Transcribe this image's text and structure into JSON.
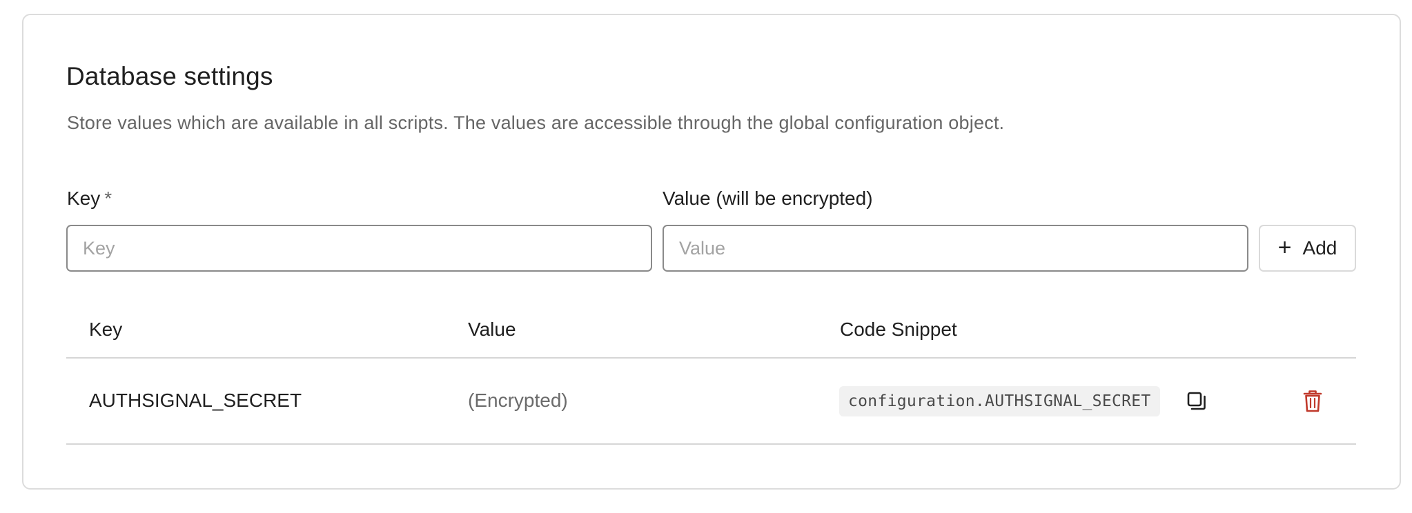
{
  "section": {
    "title": "Database settings",
    "description": "Store values which are available in all scripts. The values are accessible through the global configuration object."
  },
  "form": {
    "key_label": "Key",
    "required_marker": "*",
    "key_placeholder": "Key",
    "value_label": "Value (will be encrypted)",
    "value_placeholder": "Value",
    "add_label": "Add",
    "add_icon": "+"
  },
  "table": {
    "headers": [
      "Key",
      "Value",
      "Code Snippet"
    ],
    "rows": [
      {
        "key": "AUTHSIGNAL_SECRET",
        "value": "(Encrypted)",
        "snippet": "configuration.AUTHSIGNAL_SECRET"
      }
    ]
  },
  "icons": {
    "copy": "copy-icon",
    "delete": "trash-icon"
  },
  "colors": {
    "delete_icon": "#c0392b",
    "border": "#dcdcdc",
    "muted_text": "#666666"
  }
}
